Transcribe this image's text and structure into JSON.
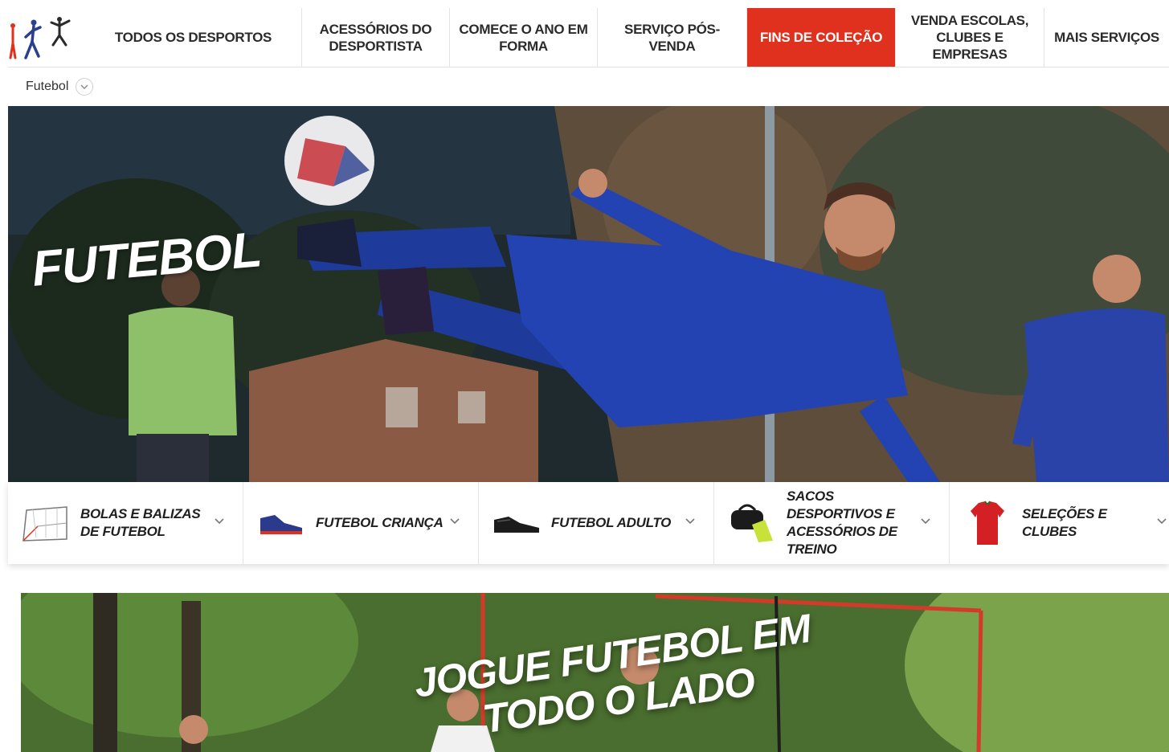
{
  "nav": {
    "logo_icon": "sport-figures-logo",
    "items": [
      {
        "label": "TODOS OS DESPORTOS"
      },
      {
        "label": "ACESSÓRIOS DO DESPORTISTA"
      },
      {
        "label": "COMECE O ANO EM FORMA"
      },
      {
        "label": "SERVIÇO PÓS-VENDA"
      },
      {
        "label": "FINS DE COLEÇÃO",
        "active": true
      },
      {
        "label": "VENDA ESCOLAS, CLUBES E EMPRESAS"
      },
      {
        "label": "MAIS SERVIÇOS"
      }
    ],
    "active_color": "#e0301e"
  },
  "breadcrumb": {
    "label": "Futebol",
    "icon": "chevron-down-icon"
  },
  "hero": {
    "title": "FUTEBOL"
  },
  "categories": [
    {
      "label": "BOLAS E BALIZAS DE FUTEBOL",
      "icon": "goal-icon"
    },
    {
      "label": "FUTEBOL CRIANÇA",
      "icon": "kids-boot-icon"
    },
    {
      "label": "FUTEBOL ADULTO",
      "icon": "adult-boot-icon"
    },
    {
      "label": "SACOS DESPORTIVOS E ACESSÓRIOS DE TREINO",
      "icon": "sports-bag-icon"
    },
    {
      "label": "SELEÇÕES E CLUBES",
      "icon": "jersey-icon"
    }
  ],
  "promo": {
    "title": "JOGUE FUTEBOL EM TODO O LADO"
  }
}
